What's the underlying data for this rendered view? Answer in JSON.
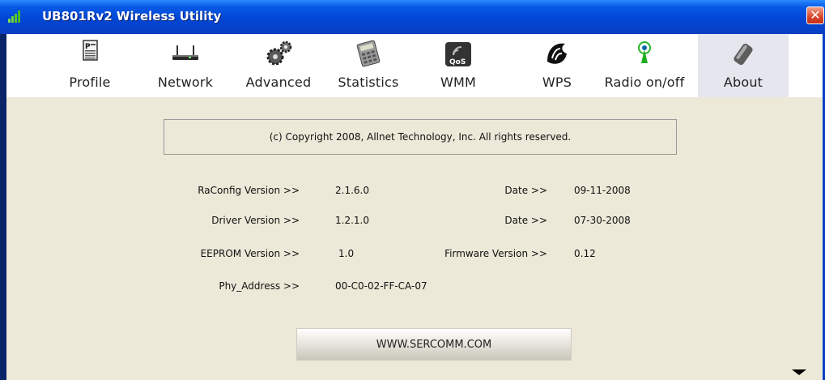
{
  "window": {
    "title": "UB801Rv2 Wireless Utility",
    "close_glyph": "✕"
  },
  "toolbar": {
    "items": [
      {
        "label": "Profile",
        "icon": "profile-icon"
      },
      {
        "label": "Network",
        "icon": "network-icon"
      },
      {
        "label": "Advanced",
        "icon": "gears-icon"
      },
      {
        "label": "Statistics",
        "icon": "calculator-icon"
      },
      {
        "label": "WMM",
        "icon": "qos-icon"
      },
      {
        "label": "WPS",
        "icon": "wps-icon"
      },
      {
        "label": "Radio on/off",
        "icon": "antenna-icon"
      },
      {
        "label": "About",
        "icon": "usb-adapter-icon"
      }
    ],
    "active": "About"
  },
  "about": {
    "copyright": "(c) Copyright 2008, Allnet Technology, Inc.  All rights reserved.",
    "raconfig_label": "RaConfig Version >>",
    "raconfig_value": "2.1.6.0",
    "raconfig_date_label": "Date >>",
    "raconfig_date_value": "09-11-2008",
    "driver_label": "Driver Version >>",
    "driver_value": "1.2.1.0",
    "driver_date_label": "Date >>",
    "driver_date_value": "07-30-2008",
    "eeprom_label": "EEPROM Version >>",
    "eeprom_value": "1.0",
    "firmware_label": "Firmware Version >>",
    "firmware_value": "0.12",
    "phy_label": "Phy_Address >>",
    "phy_value": "00-C0-02-FF-CA-07",
    "website": "WWW.SERCOMM.COM"
  }
}
